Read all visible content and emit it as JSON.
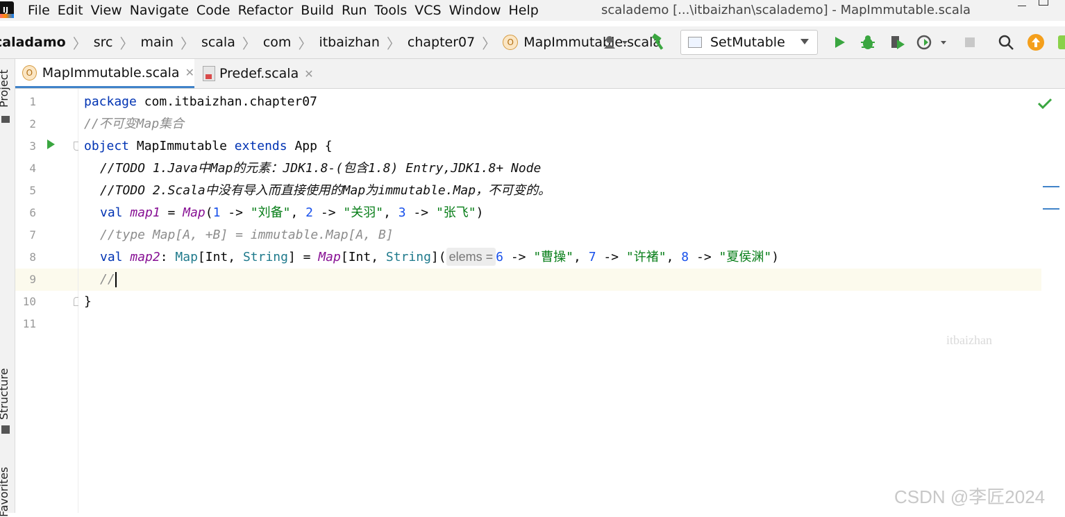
{
  "menubar": {
    "items": [
      "File",
      "Edit",
      "View",
      "Navigate",
      "Code",
      "Refactor",
      "Build",
      "Run",
      "Tools",
      "VCS",
      "Window",
      "Help"
    ],
    "title": "scalademo [...\\itbaizhan\\scalademo] - MapImmutable.scala"
  },
  "breadcrumbs": [
    "caladamo",
    "src",
    "main",
    "scala",
    "com",
    "itbaizhan",
    "chapter07",
    "MapImmutable.scala"
  ],
  "run_config": {
    "selected": "SetMutable"
  },
  "colors": {
    "accent": "#4083c9",
    "run_green": "#3aa640",
    "update_orange": "#f49f1c"
  },
  "left_tool_windows": [
    "Project",
    "Structure",
    "Favorites"
  ],
  "tabs": [
    {
      "label": "MapImmutable.scala",
      "active": true
    },
    {
      "label": "Predef.scala",
      "active": false
    }
  ],
  "editor": {
    "line_numbers": [
      "1",
      "2",
      "3",
      "4",
      "5",
      "6",
      "7",
      "8",
      "9",
      "10",
      "11"
    ],
    "code": {
      "l1_kw": "package",
      "l1_pkg": " com.itbaizhan.chapter07",
      "l2": "//不可变Map集合",
      "l3_kw1": "object",
      "l3_name": " MapImmutable ",
      "l3_kw2": "extends",
      "l3_rest": " App {",
      "l4": "//TODO 1.Java中Map的元素：JDK1.8-(包含1.8) Entry,JDK1.8+ Node",
      "l5": "//TODO 2.Scala中没有导入而直接使用的Map为immutable.Map，不可变的。",
      "l6_val": "val",
      "l6_name": "map1",
      "l6_eq": " = ",
      "l6_map": "Map",
      "l6_open": "(",
      "l6_n1": "1",
      "l6_arrow1": " -> ",
      "l6_s1": "\"刘备\"",
      "l6_c1": ", ",
      "l6_n2": "2",
      "l6_arrow2": " -> ",
      "l6_s2": "\"关羽\"",
      "l6_c2": ", ",
      "l6_n3": "3",
      "l6_arrow3": " -> ",
      "l6_s3": "\"张飞\"",
      "l6_close": ")",
      "l7": "//type Map[A, +B] = immutable.Map[A, B]",
      "l8_val": "val",
      "l8_name": "map2",
      "l8_colon": ": ",
      "l8_type1": "Map",
      "l8_br1": "[Int, ",
      "l8_str1": "String",
      "l8_br2": "] = ",
      "l8_map": "Map",
      "l8_br3": "[Int, ",
      "l8_str2": "String",
      "l8_br4": "](",
      "l8_hint": "elems =",
      "l8_n1": "6",
      "l8_arrow1": " -> ",
      "l8_s1": "\"曹操\"",
      "l8_c1": ", ",
      "l8_n2": "7",
      "l8_arrow2": " -> ",
      "l8_s2": "\"许褚\"",
      "l8_c2": ", ",
      "l8_n3": "8",
      "l8_arrow3": " -> ",
      "l8_s3": "\"夏侯渊\"",
      "l8_close": ")",
      "l9": "//",
      "l10": "}"
    }
  },
  "watermarks": {
    "bottom": "CSDN @李匠2024",
    "center": "itbaizhan"
  }
}
